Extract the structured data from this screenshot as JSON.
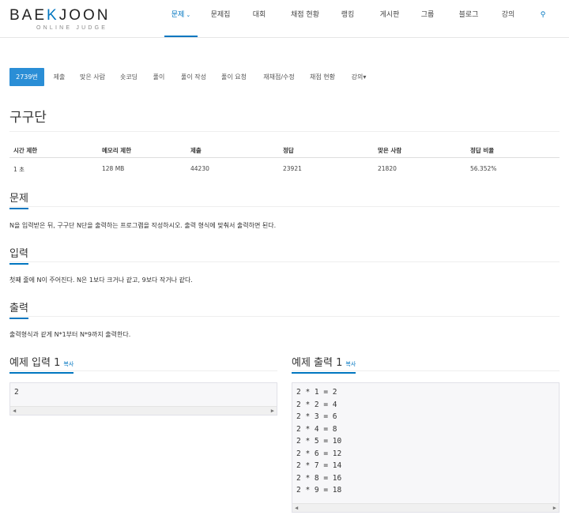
{
  "logo": {
    "main_pre": "BAE",
    "main_k": "K",
    "main_post": "JOON",
    "sub": "ONLINE JUDGE"
  },
  "nav": {
    "items": [
      "문제",
      "문제집",
      "대회",
      "채점 현황",
      "랭킹",
      "게시판",
      "그룹",
      "블로그",
      "강의"
    ],
    "caret": "⌄",
    "search_icon": "⚲"
  },
  "tabs": {
    "items": [
      "2739번",
      "제출",
      "맞은 사람",
      "숏코딩",
      "풀이",
      "풀이 작성",
      "풀이 요청",
      "재채점/수정",
      "채점 현황",
      "강의▾"
    ]
  },
  "problem": {
    "title": "구구단",
    "stats_headers": [
      "시간 제한",
      "메모리 제한",
      "제출",
      "정답",
      "맞은 사람",
      "정답 비율"
    ],
    "stats_values": [
      "1 초",
      "128 MB",
      "44230",
      "23921",
      "21820",
      "56.352%"
    ]
  },
  "sections": {
    "description_title": "문제",
    "description_text": "N을 입력받은 뒤, 구구단 N단을 출력하는 프로그램을 작성하시오. 출력 형식에 맞춰서 출력하면 된다.",
    "input_title": "입력",
    "input_text": "첫째 줄에 N이 주어진다. N은 1보다 크거나 같고, 9보다 작거나 같다.",
    "output_title": "출력",
    "output_text": "출력형식과 같게 N*1부터 N*9까지 출력한다."
  },
  "samples": {
    "input_title": "예제 입력 1",
    "output_title": "예제 출력 1",
    "copy_label": "복사",
    "input_text": "2",
    "output_text": "2 * 1 = 2\n2 * 2 = 4\n2 * 3 = 6\n2 * 4 = 8\n2 * 5 = 10\n2 * 6 = 12\n2 * 7 = 14\n2 * 8 = 16\n2 * 9 = 18",
    "scroll_left": "◀",
    "scroll_right": "▶"
  },
  "colors": {
    "accent": "#0076c0",
    "tab_active": "#2a8ed6"
  }
}
